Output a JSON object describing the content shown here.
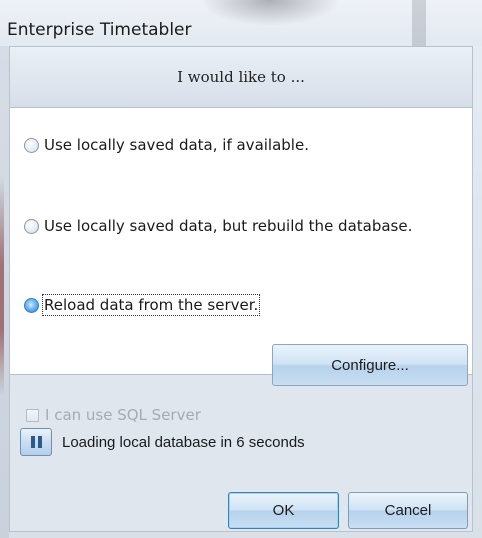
{
  "window": {
    "title": "Enterprise Timetabler"
  },
  "header": {
    "text": "I would like to ..."
  },
  "options": [
    {
      "label": "Use locally saved data, if available.",
      "checked": false
    },
    {
      "label": "Use locally saved data, but rebuild the database.",
      "checked": false
    },
    {
      "label": "Reload data from the server.",
      "checked": true
    }
  ],
  "sql": {
    "label": "I can use SQL Server",
    "checked": false,
    "enabled": false
  },
  "buttons": {
    "configure": "Configure...",
    "ok": "OK",
    "cancel": "Cancel"
  },
  "status": {
    "text": "Loading local database in 6 seconds",
    "pause_icon": "pause-icon"
  },
  "colors": {
    "selected_radio": "#2d7fd1",
    "button_border": "#7f9db9"
  }
}
